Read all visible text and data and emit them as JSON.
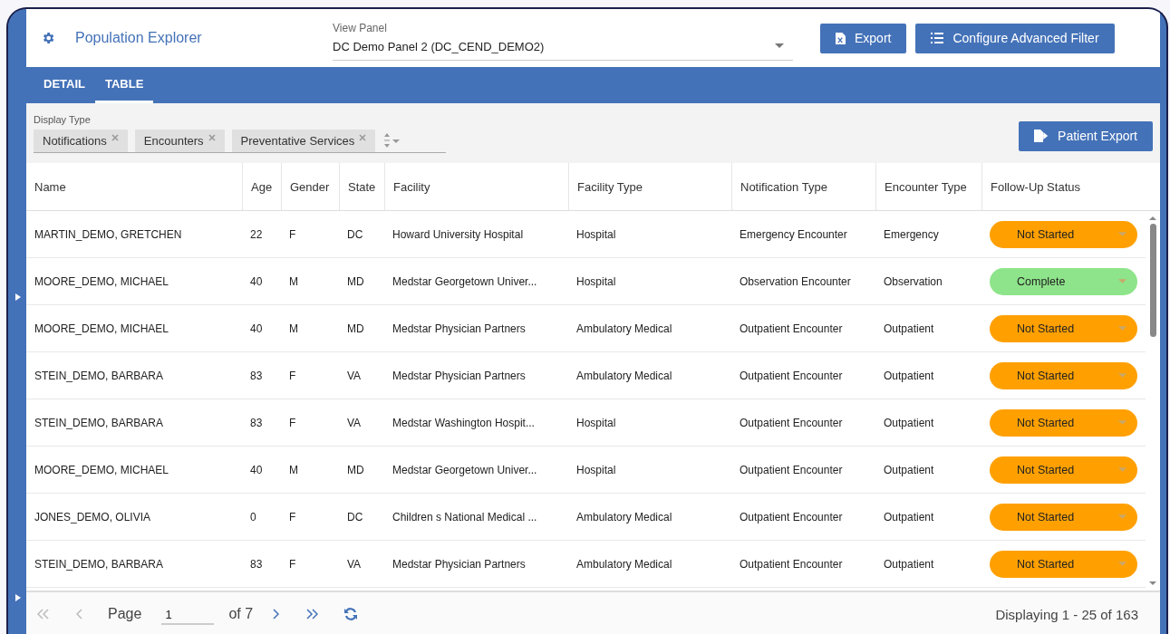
{
  "header": {
    "title": "Population Explorer",
    "view_panel": {
      "label": "View Panel",
      "value": "DC Demo Panel 2 (DC_CEND_DEMO2)"
    },
    "buttons": [
      {
        "kind": "excel",
        "label": "Export"
      },
      {
        "kind": "list",
        "label": "Configure Advanced Filter"
      }
    ]
  },
  "tabs": [
    {
      "label": "DETAIL",
      "selected": false
    },
    {
      "label": "TABLE",
      "selected": true
    }
  ],
  "display_type": {
    "label": "Display Type",
    "chips": [
      "Notifications",
      "Encounters",
      "Preventative Services"
    ]
  },
  "patient_export": "Patient Export",
  "table": {
    "columns": [
      "Name",
      "Age",
      "Gender",
      "State",
      "Facility",
      "Facility Type",
      "Notification Type",
      "Encounter Type",
      "Follow-Up Status"
    ],
    "rows": [
      {
        "cells": [
          "MARTIN_DEMO, GRETCHEN",
          "22",
          "F",
          "DC",
          "Howard University Hospital",
          "Hospital",
          "Emergency Encounter",
          "Emergency"
        ],
        "status": "Not Started",
        "color": "#ffa000"
      },
      {
        "cells": [
          "MOORE_DEMO, MICHAEL",
          "40",
          "M",
          "MD",
          "Medstar Georgetown Univer...",
          "Hospital",
          "Observation Encounter",
          "Observation"
        ],
        "status": "Complete",
        "color": "#8ee48a"
      },
      {
        "cells": [
          "MOORE_DEMO, MICHAEL",
          "40",
          "M",
          "MD",
          "Medstar Physician Partners",
          "Ambulatory Medical",
          "Outpatient Encounter",
          "Outpatient"
        ],
        "status": "Not Started",
        "color": "#ffa000"
      },
      {
        "cells": [
          "STEIN_DEMO, BARBARA",
          "83",
          "F",
          "VA",
          "Medstar Physician Partners",
          "Ambulatory Medical",
          "Outpatient Encounter",
          "Outpatient"
        ],
        "status": "Not Started",
        "color": "#ffa000"
      },
      {
        "cells": [
          "STEIN_DEMO, BARBARA",
          "83",
          "F",
          "VA",
          "Medstar Washington Hospit...",
          "Hospital",
          "Outpatient Encounter",
          "Outpatient"
        ],
        "status": "Not Started",
        "color": "#ffa000"
      },
      {
        "cells": [
          "MOORE_DEMO, MICHAEL",
          "40",
          "M",
          "MD",
          "Medstar Georgetown Univer...",
          "Hospital",
          "Outpatient Encounter",
          "Outpatient"
        ],
        "status": "Not Started",
        "color": "#ffa000"
      },
      {
        "cells": [
          "JONES_DEMO, OLIVIA",
          "0",
          "F",
          "DC",
          "Children s National Medical ...",
          "Ambulatory Medical",
          "Outpatient Encounter",
          "Outpatient"
        ],
        "status": "Not Started",
        "color": "#ffa000"
      },
      {
        "cells": [
          "STEIN_DEMO, BARBARA",
          "83",
          "F",
          "VA",
          "Medstar Physician Partners",
          "Ambulatory Medical",
          "Outpatient Encounter",
          "Outpatient"
        ],
        "status": "Not Started",
        "color": "#ffa000"
      }
    ]
  },
  "pager": {
    "page_label": "Page",
    "page": "1",
    "of": "of 7",
    "summary": "Displaying 1 - 25 of 163"
  }
}
